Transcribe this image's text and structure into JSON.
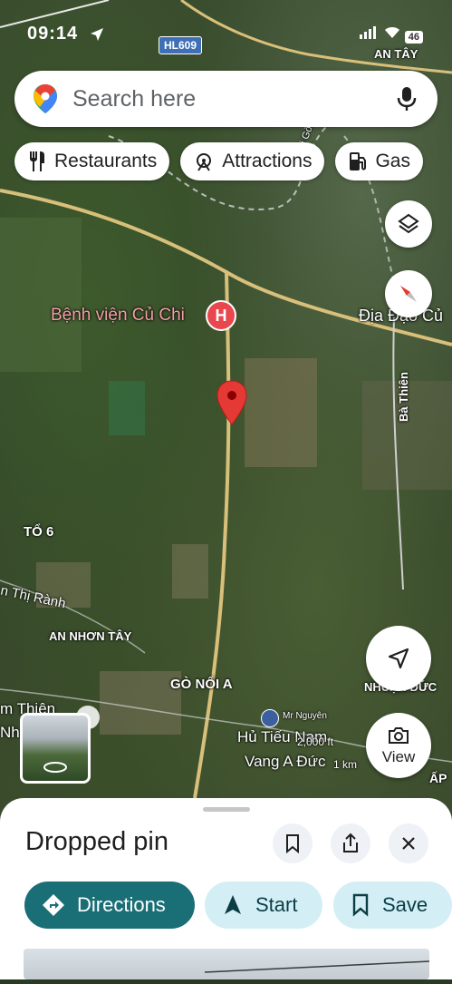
{
  "status_bar": {
    "time": "09:14",
    "battery": "46"
  },
  "map": {
    "route_badge": "HL609",
    "labels": {
      "an_tay": "AN TÂY",
      "song_sai_gon": "Sông Sài Gòn",
      "hospital": "Bệnh viện Củ Chi",
      "dia_dao": "Địa Đạo Củ",
      "ba_thien": "Bà Thiên",
      "to6": "TỔ 6",
      "thi_ranh": "n Thị Rành",
      "an_nhon_tay": "AN NHƠN TÂY",
      "go_noi_a": "GÒ NỔI A",
      "nhuan_duc": "NHUẬN ĐỨC",
      "m_thien": "m Thiên",
      "nh": "Nh",
      "mr_nguyen": "Mr Nguyên",
      "hu_tieu_1": "Hủ Tiếu Nam",
      "hu_tieu_2": "Vang A Đức",
      "ap": "ẤP",
      "scale": "2,000 ft",
      "scale_km": "1 km"
    }
  },
  "search": {
    "placeholder": "Search here"
  },
  "chips": [
    {
      "label": "Restaurants",
      "icon": "restaurant-icon"
    },
    {
      "label": "Attractions",
      "icon": "attractions-icon"
    },
    {
      "label": "Gas",
      "icon": "gas-icon"
    }
  ],
  "controls": {
    "view_label": "View"
  },
  "sheet": {
    "title": "Dropped pin",
    "directions_label": "Directions",
    "start_label": "Start",
    "save_label": "Save"
  },
  "colors": {
    "accent_teal": "#1a6e76",
    "light_teal": "#d3eef5",
    "pin_red": "#e53935"
  }
}
